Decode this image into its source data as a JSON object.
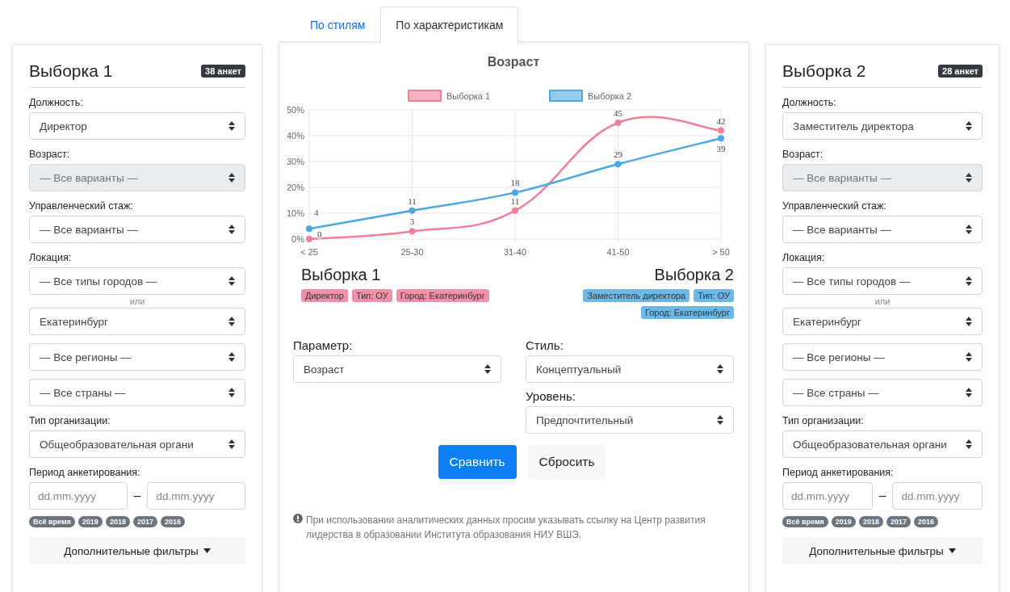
{
  "samples_left": {
    "title": "Выборка 1",
    "count": "38 анкет",
    "fields": [
      {
        "kind": "select",
        "label": "Должность:",
        "value": "Директор",
        "disabled": false
      },
      {
        "kind": "select",
        "label": "Возраст:",
        "value": "— Все варианты —",
        "disabled": true
      },
      {
        "kind": "select",
        "label": "Управленческий стаж:",
        "value": "— Все варианты —",
        "disabled": false
      },
      {
        "kind": "select",
        "label": "Локация:",
        "value": "— Все типы городов —",
        "disabled": false
      },
      {
        "kind": "or",
        "text": "или"
      },
      {
        "kind": "select",
        "value": "Екатеринбург",
        "disabled": false
      },
      {
        "kind": "select",
        "value": "— Все регионы —",
        "disabled": false
      },
      {
        "kind": "select",
        "value": "— Все страны —",
        "disabled": false
      },
      {
        "kind": "select",
        "label": "Тип организации:",
        "value": "Общеобразовательная органи",
        "disabled": false
      },
      {
        "kind": "dates",
        "label": "Период анкетирования:",
        "from_placeholder": "dd.mm.yyyy",
        "dash": "–",
        "to_placeholder": "dd.mm.yyyy"
      }
    ],
    "periods": [
      "Всё время",
      "2019",
      "2018",
      "2017",
      "2016"
    ],
    "more_filters": "Дополнительные фильтры"
  },
  "tabs": [
    {
      "label": "По стилям",
      "selected": false
    },
    {
      "label": "По характеристикам",
      "selected": true
    }
  ],
  "chart_data": {
    "type": "line",
    "title": "Возраст",
    "categories": [
      "< 25",
      "25-30",
      "31-40",
      "41-50",
      "> 50"
    ],
    "series": [
      {
        "name": "Выборка 1",
        "color": "#f07f9a",
        "marker": "circle",
        "values": [
          0,
          3,
          11,
          45,
          42
        ]
      },
      {
        "name": "Выборка 2",
        "color": "#4ea8e0",
        "marker": "circle",
        "values": [
          4,
          11,
          18,
          29,
          39
        ]
      }
    ],
    "grid": true,
    "legend": true,
    "ylim": [
      0,
      50
    ],
    "yticks": [
      {
        "value": 0,
        "label": "0%"
      },
      {
        "value": 10,
        "label": "10%"
      },
      {
        "value": 20,
        "label": "20%"
      },
      {
        "value": 30,
        "label": "30%"
      },
      {
        "value": 40,
        "label": "40%"
      },
      {
        "value": 50,
        "label": "50%"
      }
    ],
    "data_labels": true
  },
  "summaries": [
    {
      "title": "Выборка 1",
      "color": "#f190a6",
      "tags": [
        "Директор",
        "Тип: ОУ",
        "Город: Екатеринбург"
      ]
    },
    {
      "title": "Выборка 2",
      "color": "#6cb9e8",
      "tags": [
        "Заместитель директора",
        "Тип: ОУ",
        "Город: Екатеринбург"
      ]
    }
  ],
  "params": [
    {
      "label": "Параметр:",
      "value": "Возраст"
    },
    {
      "label": "Стиль:",
      "value": "Концептуальный"
    },
    {
      "label": "Уровень:",
      "value": "Предпочтительный"
    }
  ],
  "buttons": [
    {
      "label": "Сравнить",
      "kind": "primary"
    },
    {
      "label": "Сбросить",
      "kind": "secondary"
    }
  ],
  "note": "При использовании аналитических данных просим указывать ссылку на Центр развития лидерства в образовании Института образования НИУ ВШЭ.",
  "samples_right": {
    "title": "Выборка 2",
    "count": "28 анкет",
    "fields": [
      {
        "kind": "select",
        "label": "Должность:",
        "value": "Заместитель директора",
        "disabled": false
      },
      {
        "kind": "select",
        "label": "Возраст:",
        "value": "— Все варианты —",
        "disabled": true
      },
      {
        "kind": "select",
        "label": "Управленческий стаж:",
        "value": "— Все варианты —",
        "disabled": false
      },
      {
        "kind": "select",
        "label": "Локация:",
        "value": "— Все типы городов —",
        "disabled": false
      },
      {
        "kind": "or",
        "text": "или"
      },
      {
        "kind": "select",
        "value": "Екатеринбург",
        "disabled": false
      },
      {
        "kind": "select",
        "value": "— Все регионы —",
        "disabled": false
      },
      {
        "kind": "select",
        "value": "— Все страны —",
        "disabled": false
      },
      {
        "kind": "select",
        "label": "Тип организации:",
        "value": "Общеобразовательная органи",
        "disabled": false
      },
      {
        "kind": "dates",
        "label": "Период анкетирования:",
        "from_placeholder": "dd.mm.yyyy",
        "dash": "–",
        "to_placeholder": "dd.mm.yyyy"
      }
    ],
    "periods": [
      "Всё время",
      "2019",
      "2018",
      "2017",
      "2016"
    ],
    "more_filters": "Дополнительные фильтры"
  }
}
